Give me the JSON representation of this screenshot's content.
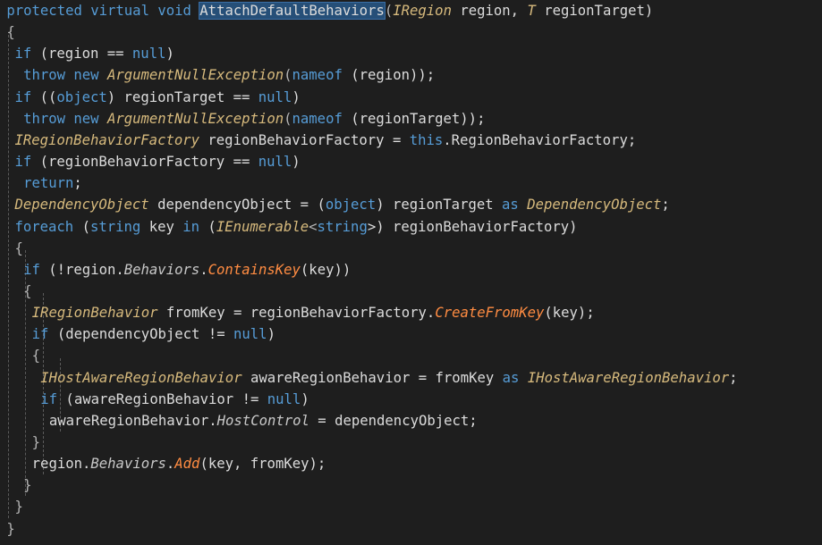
{
  "editor": {
    "language": "csharp",
    "colors": {
      "background": "#1e1e1e",
      "keyword": "#569cd6",
      "type": "#d7ba7d",
      "identifier": "#dcdcdc",
      "member": "#c8c8c8",
      "method": "#ff8c42",
      "highlight": "#264f78"
    },
    "lines": [
      {
        "tokens": [
          [
            "protected virtual void ",
            "kw"
          ],
          [
            "AttachDefaultBehaviors",
            "fn-hl"
          ],
          [
            "(",
            "punct"
          ],
          [
            "IRegion",
            "type"
          ],
          [
            " region, ",
            "ident"
          ],
          [
            "T",
            "type"
          ],
          [
            " regionTarget)",
            "ident"
          ]
        ]
      },
      {
        "tokens": [
          [
            "{",
            "punct"
          ]
        ]
      },
      {
        "tokens": [
          [
            "if",
            "kw"
          ],
          [
            " (region == ",
            "ident"
          ],
          [
            "null",
            "kw"
          ],
          [
            ")",
            "ident"
          ]
        ]
      },
      {
        "tokens": [
          [
            "throw new ",
            "kw"
          ],
          [
            "ArgumentNullException",
            "type"
          ],
          [
            "(",
            "punct"
          ],
          [
            "nameof",
            "kw"
          ],
          [
            " (region));",
            "ident"
          ]
        ]
      },
      {
        "tokens": [
          [
            "if",
            "kw"
          ],
          [
            " ((",
            "ident"
          ],
          [
            "object",
            "kw"
          ],
          [
            ") regionTarget == ",
            "ident"
          ],
          [
            "null",
            "kw"
          ],
          [
            ")",
            "ident"
          ]
        ]
      },
      {
        "tokens": [
          [
            "throw new ",
            "kw"
          ],
          [
            "ArgumentNullException",
            "type"
          ],
          [
            "(",
            "punct"
          ],
          [
            "nameof",
            "kw"
          ],
          [
            " (regionTarget));",
            "ident"
          ]
        ]
      },
      {
        "tokens": [
          [
            "IRegionBehaviorFactory",
            "type"
          ],
          [
            " regionBehaviorFactory = ",
            "ident"
          ],
          [
            "this",
            "kw"
          ],
          [
            ".RegionBehaviorFactory;",
            "ident"
          ]
        ]
      },
      {
        "tokens": [
          [
            "if",
            "kw"
          ],
          [
            " (regionBehaviorFactory == ",
            "ident"
          ],
          [
            "null",
            "kw"
          ],
          [
            ")",
            "ident"
          ]
        ]
      },
      {
        "tokens": [
          [
            "return",
            "kw"
          ],
          [
            ";",
            "ident"
          ]
        ]
      },
      {
        "tokens": [
          [
            "DependencyObject",
            "type"
          ],
          [
            " dependencyObject = (",
            "ident"
          ],
          [
            "object",
            "kw"
          ],
          [
            ") regionTarget ",
            "ident"
          ],
          [
            "as",
            "kw"
          ],
          [
            " ",
            "ident"
          ],
          [
            "DependencyObject",
            "type"
          ],
          [
            ";",
            "ident"
          ]
        ]
      },
      {
        "tokens": [
          [
            "foreach",
            "kw"
          ],
          [
            " (",
            "ident"
          ],
          [
            "string",
            "kw"
          ],
          [
            " key ",
            "ident"
          ],
          [
            "in",
            "kw"
          ],
          [
            " (",
            "ident"
          ],
          [
            "IEnumerable",
            "type"
          ],
          [
            "<",
            "punct"
          ],
          [
            "string",
            "kw"
          ],
          [
            ">) regionBehaviorFactory)",
            "ident"
          ]
        ]
      },
      {
        "tokens": [
          [
            "{",
            "punct"
          ]
        ]
      },
      {
        "tokens": [
          [
            "if",
            "kw"
          ],
          [
            " (!region.",
            "ident"
          ],
          [
            "Behaviors",
            "member"
          ],
          [
            ".",
            "ident"
          ],
          [
            "ContainsKey",
            "method"
          ],
          [
            "(key))",
            "ident"
          ]
        ]
      },
      {
        "tokens": [
          [
            "{",
            "punct"
          ]
        ]
      },
      {
        "tokens": [
          [
            "IRegionBehavior",
            "type"
          ],
          [
            " fromKey = regionBehaviorFactory.",
            "ident"
          ],
          [
            "CreateFromKey",
            "method"
          ],
          [
            "(key);",
            "ident"
          ]
        ]
      },
      {
        "tokens": [
          [
            "if",
            "kw"
          ],
          [
            " (dependencyObject != ",
            "ident"
          ],
          [
            "null",
            "kw"
          ],
          [
            ")",
            "ident"
          ]
        ]
      },
      {
        "tokens": [
          [
            "{",
            "punct"
          ]
        ]
      },
      {
        "tokens": [
          [
            "IHostAwareRegionBehavior",
            "type"
          ],
          [
            " awareRegionBehavior = fromKey ",
            "ident"
          ],
          [
            "as",
            "kw"
          ],
          [
            " ",
            "ident"
          ],
          [
            "IHostAwareRegionBehavior",
            "type"
          ],
          [
            ";",
            "ident"
          ]
        ]
      },
      {
        "tokens": [
          [
            "if",
            "kw"
          ],
          [
            " (awareRegionBehavior != ",
            "ident"
          ],
          [
            "null",
            "kw"
          ],
          [
            ")",
            "ident"
          ]
        ]
      },
      {
        "tokens": [
          [
            "awareRegionBehavior.",
            "ident"
          ],
          [
            "HostControl",
            "member"
          ],
          [
            " = dependencyObject;",
            "ident"
          ]
        ]
      },
      {
        "tokens": [
          [
            "}",
            "punct"
          ]
        ]
      },
      {
        "tokens": [
          [
            "region.",
            "ident"
          ],
          [
            "Behaviors",
            "member"
          ],
          [
            ".",
            "ident"
          ],
          [
            "Add",
            "method"
          ],
          [
            "(key, fromKey);",
            "ident"
          ]
        ]
      },
      {
        "tokens": [
          [
            "}",
            "punct"
          ]
        ]
      },
      {
        "tokens": [
          [
            "}",
            "punct"
          ]
        ]
      },
      {
        "tokens": [
          [
            "}",
            "punct"
          ]
        ]
      }
    ]
  }
}
